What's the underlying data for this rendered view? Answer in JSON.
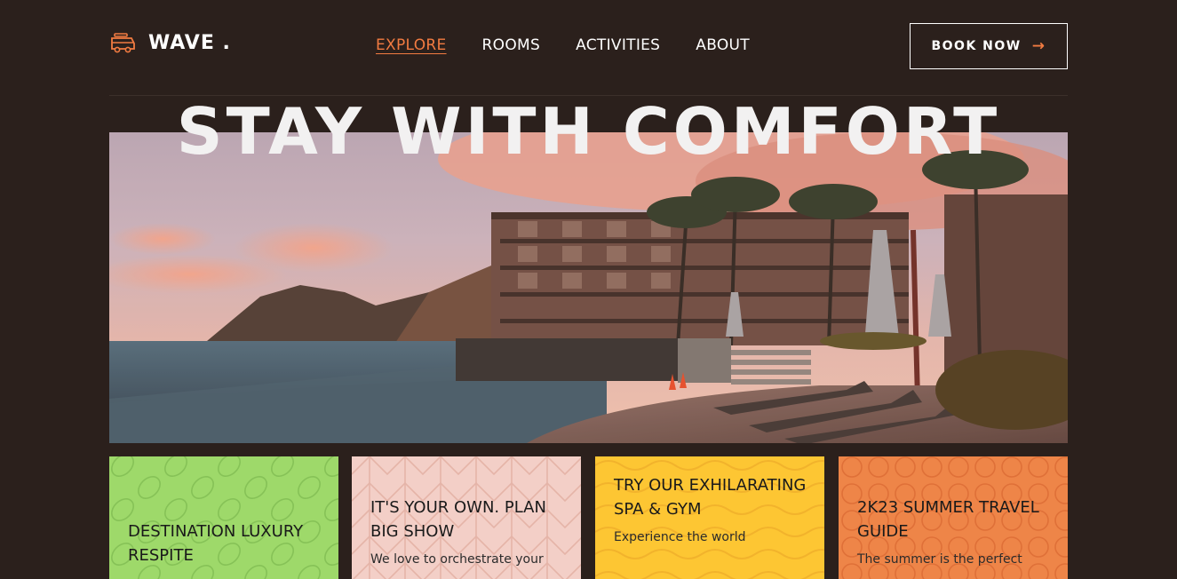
{
  "brand": {
    "name": "WAVE .",
    "icon": "van-icon",
    "accent": "#f27b41"
  },
  "nav": {
    "items": [
      {
        "label": "EXPLORE",
        "active": true
      },
      {
        "label": "ROOMS",
        "active": false
      },
      {
        "label": "ACTIVITIES",
        "active": false
      },
      {
        "label": "ABOUT",
        "active": false
      }
    ]
  },
  "book": {
    "label": "BOOK NOW",
    "icon": "arrow-right-icon"
  },
  "hero": {
    "title": "STAY WITH COMFORT"
  },
  "cards": [
    {
      "title": "DESTINATION LUXURY RESPITE",
      "text": "",
      "color": "#9ed96a"
    },
    {
      "title": "IT'S YOUR OWN. PLAN BIG SHOW",
      "text": "We love to orchestrate your",
      "color": "#f3cfc7"
    },
    {
      "title": "TRY OUR EXHILARATING SPA & GYM",
      "text": "Experience the world",
      "color": "#fdc633"
    },
    {
      "title": "2K23 SUMMER TRAVEL GUIDE",
      "text": "The summer is the perfect",
      "color": "#ee8548"
    }
  ]
}
